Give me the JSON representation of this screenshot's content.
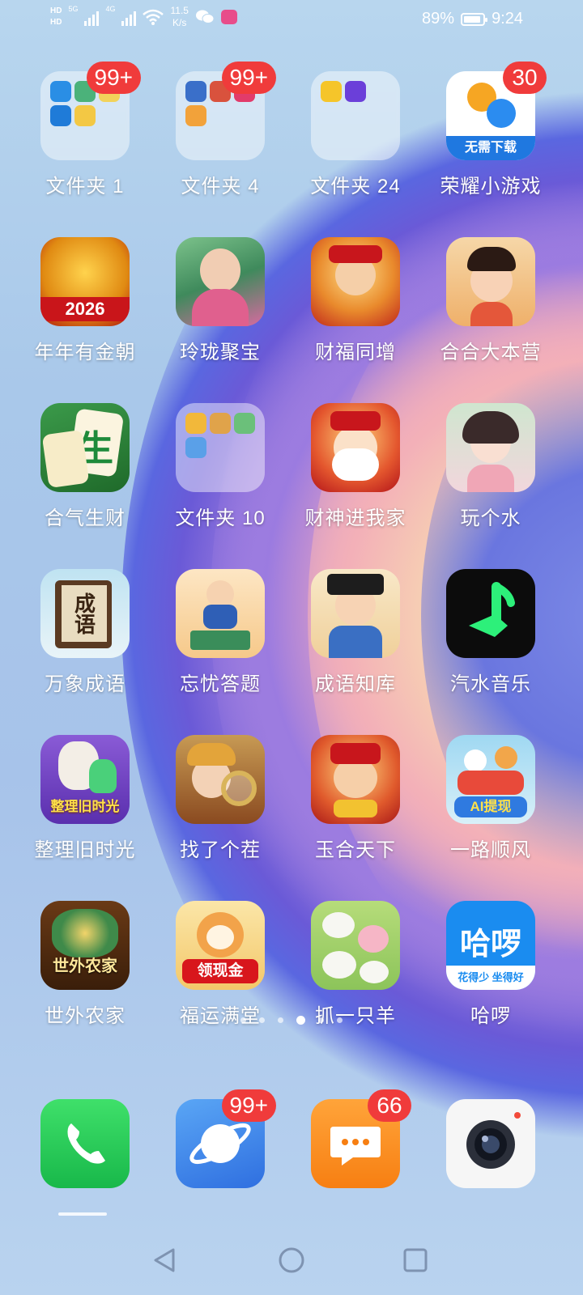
{
  "status_bar": {
    "hd_top": "HD",
    "hd_bottom": "HD",
    "net1": "5G",
    "net2": "4G",
    "speed_value": "11.5",
    "speed_unit": "K/s",
    "battery": "89%",
    "battery_level": 0.89,
    "time": "9:24"
  },
  "apps": [
    {
      "label": "文件夹 1",
      "badge": "99+",
      "type": "folder"
    },
    {
      "label": "文件夹 4",
      "badge": "99+",
      "type": "folder"
    },
    {
      "label": "文件夹 24",
      "badge": "",
      "type": "folder"
    },
    {
      "label": "荣耀小游戏",
      "badge": "30",
      "type": "app",
      "icon_text": "无需下载"
    },
    {
      "label": "年年有金朝",
      "badge": "",
      "type": "app",
      "icon_text": "2026"
    },
    {
      "label": "玲珑聚宝",
      "badge": "",
      "type": "app"
    },
    {
      "label": "财福同增",
      "badge": "",
      "type": "app"
    },
    {
      "label": "合合大本营",
      "badge": "",
      "type": "app"
    },
    {
      "label": "合气生财",
      "badge": "",
      "type": "app",
      "icon_text": "生"
    },
    {
      "label": "文件夹 10",
      "badge": "",
      "type": "folder"
    },
    {
      "label": "财神进我家",
      "badge": "",
      "type": "app"
    },
    {
      "label": "玩个水",
      "badge": "",
      "type": "app"
    },
    {
      "label": "万象成语",
      "badge": "",
      "type": "app",
      "icon_text": "成语"
    },
    {
      "label": "忘忧答题",
      "badge": "",
      "type": "app"
    },
    {
      "label": "成语知库",
      "badge": "",
      "type": "app"
    },
    {
      "label": "汽水音乐",
      "badge": "",
      "type": "app"
    },
    {
      "label": "整理旧时光",
      "badge": "",
      "type": "app",
      "icon_text": "整理旧时光"
    },
    {
      "label": "找了个茬",
      "badge": "",
      "type": "app"
    },
    {
      "label": "玉合天下",
      "badge": "",
      "type": "app"
    },
    {
      "label": "一路顺风",
      "badge": "",
      "type": "app",
      "icon_text": "AI提现"
    },
    {
      "label": "世外农家",
      "badge": "",
      "type": "app",
      "icon_text": "世外农家"
    },
    {
      "label": "福运满堂",
      "badge": "",
      "type": "app",
      "icon_text": "领现金"
    },
    {
      "label": "抓一只羊",
      "badge": "",
      "type": "app"
    },
    {
      "label": "哈啰",
      "badge": "",
      "type": "app",
      "icon_text": "哈啰",
      "icon_sub": "花得少 坐得好"
    }
  ],
  "page_indicator": {
    "count": 6,
    "active": 3
  },
  "dock": [
    {
      "name": "phone",
      "badge": ""
    },
    {
      "name": "browser",
      "badge": "99+"
    },
    {
      "name": "messages",
      "badge": "66"
    },
    {
      "name": "camera",
      "badge": ""
    }
  ]
}
